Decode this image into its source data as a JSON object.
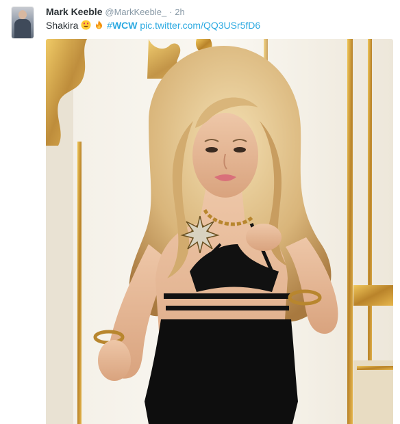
{
  "tweet": {
    "author_name": "Mark Keeble",
    "author_handle": "@MarkKeeble_",
    "separator": "·",
    "timestamp": "2h",
    "text_prefix": "Shakira",
    "emojis": [
      "heart-eyes-icon",
      "fire-icon"
    ],
    "hashtag_symbol": "#",
    "hashtag_word": "WCW",
    "link_text": "pic.twitter.com/QQ3USr5fD6"
  },
  "colors": {
    "link": "#2ba9e1",
    "text": "#292f33",
    "muted": "#8899a6",
    "gold": "#c99a2e"
  }
}
